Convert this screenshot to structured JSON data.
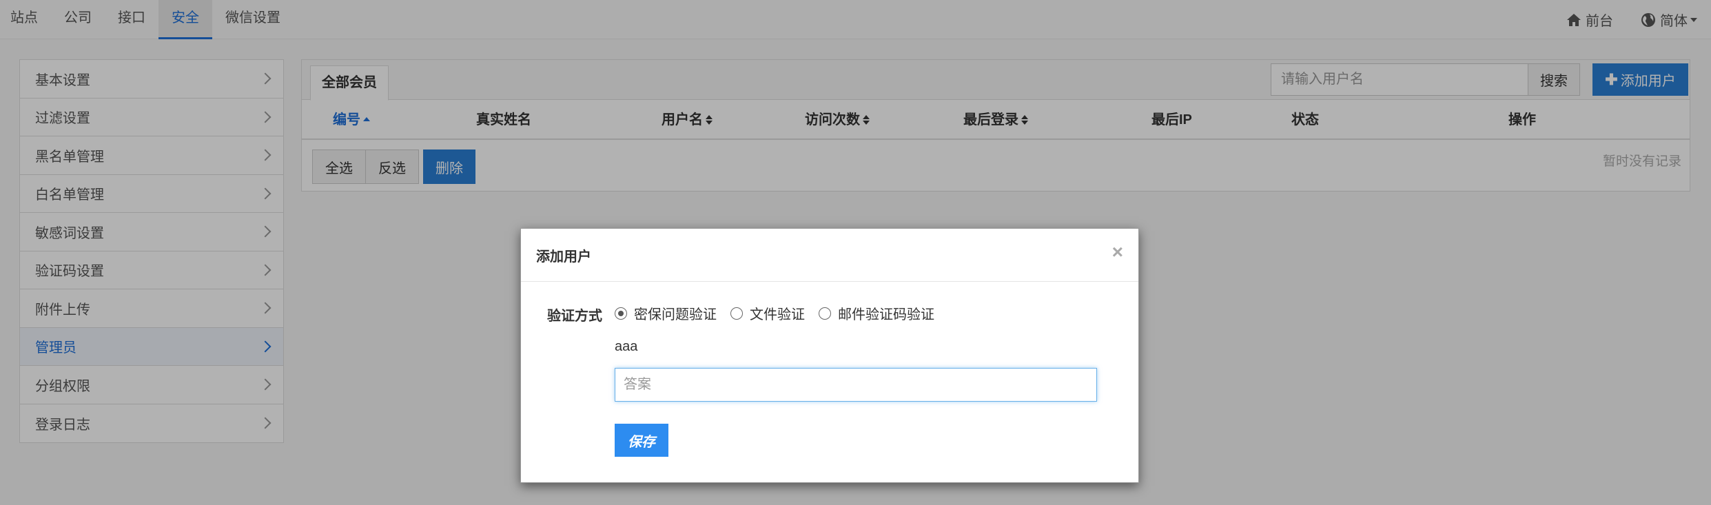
{
  "topnav": {
    "items": [
      {
        "label": "站点"
      },
      {
        "label": "公司"
      },
      {
        "label": "接口"
      },
      {
        "label": "安全",
        "active": true
      },
      {
        "label": "微信设置"
      }
    ],
    "frontend_label": "前台",
    "language_label": "简体"
  },
  "sidebar": {
    "items": [
      {
        "label": "基本设置"
      },
      {
        "label": "过滤设置"
      },
      {
        "label": "黑名单管理"
      },
      {
        "label": "白名单管理"
      },
      {
        "label": "敏感词设置"
      },
      {
        "label": "验证码设置"
      },
      {
        "label": "附件上传"
      },
      {
        "label": "管理员",
        "active": true
      },
      {
        "label": "分组权限"
      },
      {
        "label": "登录日志"
      }
    ]
  },
  "main": {
    "tab_label": "全部会员",
    "search_placeholder": "请输入用户名",
    "search_button": "搜索",
    "add_button": "添加用户",
    "columns": [
      "编号",
      "真实姓名",
      "用户名",
      "访问次数",
      "最后登录",
      "最后IP",
      "状态",
      "操作"
    ],
    "select_all": "全选",
    "invert_select": "反选",
    "delete": "删除",
    "empty_text": "暂时没有记录"
  },
  "modal": {
    "title": "添加用户",
    "close": "×",
    "verify_label": "验证方式",
    "verify_options": [
      {
        "label": "密保问题验证",
        "checked": true
      },
      {
        "label": "文件验证",
        "checked": false
      },
      {
        "label": "邮件验证码验证",
        "checked": false
      }
    ],
    "question": "aaa",
    "answer_placeholder": "答案",
    "save": "保存"
  },
  "colors": {
    "accent": "#1e6fd9",
    "primary_button": "#2a7fd4",
    "save_button": "#2d8cf0"
  }
}
